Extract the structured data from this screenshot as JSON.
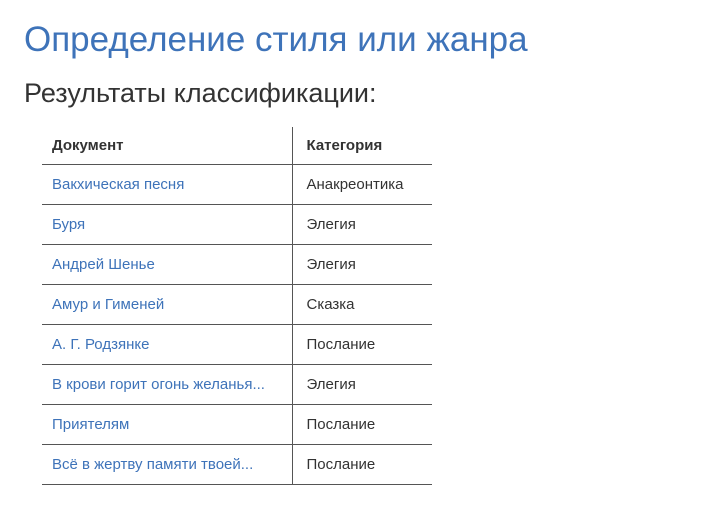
{
  "title": "Определение стиля или жанра",
  "subtitle": "Результаты классификации:",
  "table": {
    "headers": {
      "doc": "Документ",
      "cat": "Категория"
    },
    "rows": [
      {
        "doc": "Вакхическая песня",
        "cat": "Анакреонтика"
      },
      {
        "doc": "Буря",
        "cat": "Элегия"
      },
      {
        "doc": "Андрей Шенье",
        "cat": "Элегия"
      },
      {
        "doc": "Амур и Гименей",
        "cat": "Сказка"
      },
      {
        "doc": "А. Г. Родзянке",
        "cat": "Послание"
      },
      {
        "doc": "В крови горит огонь желанья...",
        "cat": "Элегия"
      },
      {
        "doc": "Приятелям",
        "cat": "Послание"
      },
      {
        "doc": "Всё в жертву памяти твоей...",
        "cat": "Послание"
      }
    ]
  }
}
